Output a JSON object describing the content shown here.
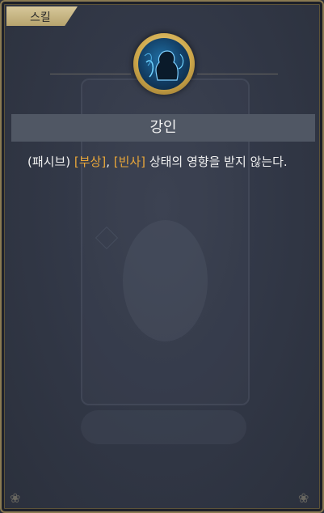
{
  "tab": {
    "label": "스킬"
  },
  "skill": {
    "name": "강인",
    "icon": "strong-will-icon",
    "description": {
      "part1": "(패시브) ",
      "hl1": "[부상]",
      "part2": ", ",
      "hl2": "[빈사]",
      "part3": " 상태의 영향을 받지 않는다."
    }
  },
  "colors": {
    "frame_gold": "#8a7a52",
    "tab_gold": "#c9b984",
    "highlight": "#e9a73a",
    "title_bar": "#505764",
    "panel_bg": "#323847"
  }
}
